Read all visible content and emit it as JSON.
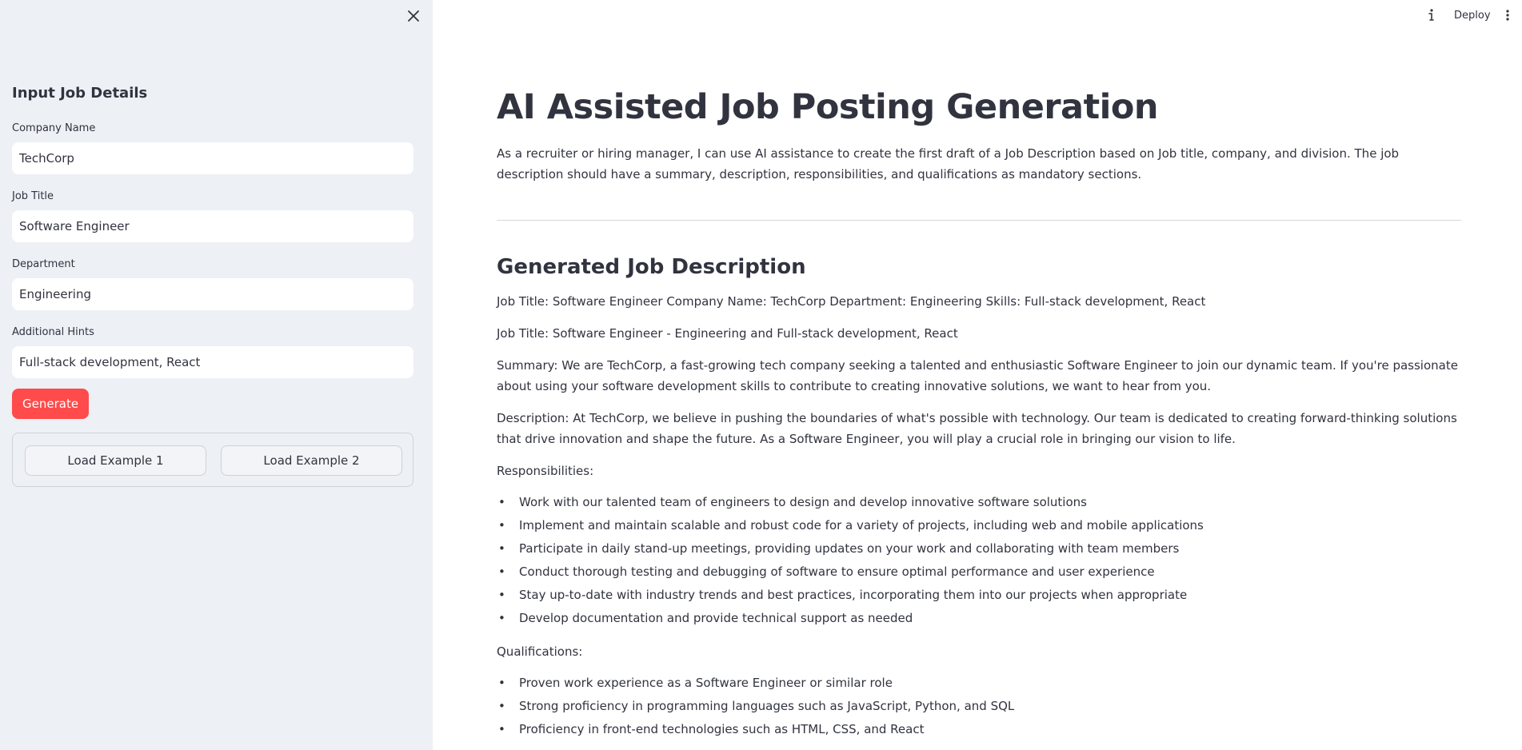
{
  "sidebar": {
    "heading": "Input Job Details",
    "fields": [
      {
        "label": "Company Name",
        "value": "TechCorp"
      },
      {
        "label": "Job Title",
        "value": "Software Engineer"
      },
      {
        "label": "Department",
        "value": "Engineering"
      },
      {
        "label": "Additional Hints",
        "value": "Full-stack development, React"
      }
    ],
    "generate_label": "Generate",
    "example_buttons": [
      "Load Example 1",
      "Load Example 2"
    ],
    "close_icon": "close-icon"
  },
  "topbar": {
    "deploy_label": "Deploy",
    "info_icon": "info-icon",
    "menu_icon": "more-vertical-icon"
  },
  "main": {
    "title": "AI Assisted Job Posting Generation",
    "intro": "As a recruiter or hiring manager, I can use AI assistance to create the first draft of a Job Description based on Job title, company, and division. The job description should have a summary, description, responsibilities, and qualifications as mandatory sections.",
    "section_title": "Generated Job Description",
    "line1": "Job Title: Software Engineer Company Name: TechCorp Department: Engineering Skills: Full-stack development, React",
    "line2": "Job Title: Software Engineer - Engineering and Full-stack development, React",
    "summary": "Summary: We are TechCorp, a fast-growing tech company seeking a talented and enthusiastic Software Engineer to join our dynamic team. If you're passionate about using your software development skills to contribute to creating innovative solutions, we want to hear from you.",
    "description": "Description: At TechCorp, we believe in pushing the boundaries of what's possible with technology. Our team is dedicated to creating forward-thinking solutions that drive innovation and shape the future. As a Software Engineer, you will play a crucial role in bringing our vision to life.",
    "responsibilities_label": "Responsibilities:",
    "responsibilities": [
      "Work with our talented team of engineers to design and develop innovative software solutions",
      "Implement and maintain scalable and robust code for a variety of projects, including web and mobile applications",
      "Participate in daily stand-up meetings, providing updates on your work and collaborating with team members",
      "Conduct thorough testing and debugging of software to ensure optimal performance and user experience",
      "Stay up-to-date with industry trends and best practices, incorporating them into our projects when appropriate",
      "Develop documentation and provide technical support as needed"
    ],
    "qualifications_label": "Qualifications:",
    "qualifications": [
      "Proven work experience as a Software Engineer or similar role",
      "Strong proficiency in programming languages such as JavaScript, Python, and SQL",
      "Proficiency in front-end technologies such as HTML, CSS, and React"
    ]
  },
  "colors": {
    "sidebar_bg": "#edf0f5",
    "primary_button": "#ff4b4b",
    "text": "#31333f"
  }
}
